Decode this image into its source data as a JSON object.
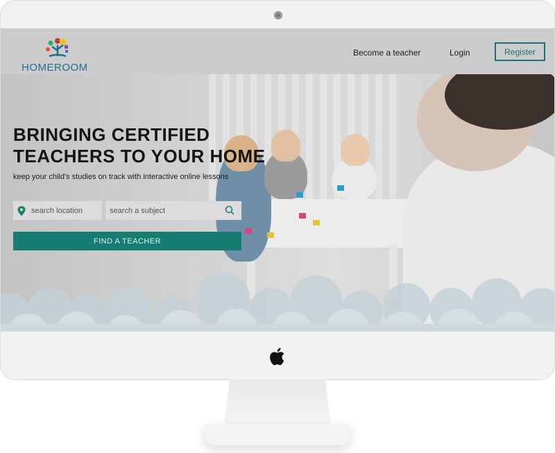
{
  "brand": {
    "name": "HOMEROOM",
    "color": "#1e6f8c"
  },
  "nav": {
    "become_teacher": "Become a teacher",
    "login": "Login",
    "register": "Register"
  },
  "hero": {
    "title_line1": "BRINGING CERTIFIED",
    "title_line2": "TEACHERS TO YOUR HOME",
    "subtitle": "keep your child's studies on track with interactive online lessons"
  },
  "search": {
    "location_placeholder": "search location",
    "subject_placeholder": "search a subject",
    "button_label": "FIND A TEACHER"
  },
  "colors": {
    "accent": "#177d72",
    "register_border": "#1f6e75"
  },
  "icons": [
    "camera-icon",
    "location-pin-icon",
    "search-icon",
    "apple-logo-icon",
    "homeroom-logo-icon"
  ]
}
